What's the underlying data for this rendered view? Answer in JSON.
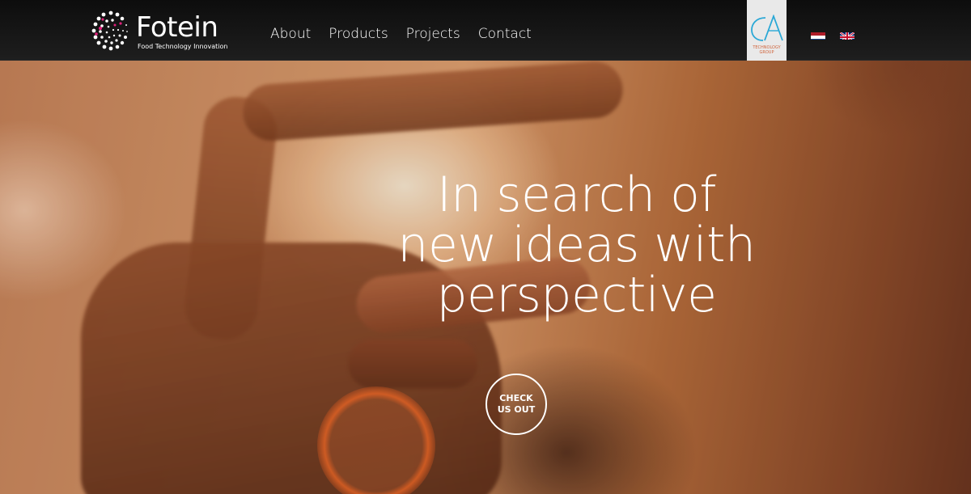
{
  "brand": {
    "name": "Fotein",
    "tagline": "Food Technology Innovation"
  },
  "nav": {
    "items": [
      {
        "label": "About"
      },
      {
        "label": "Products"
      },
      {
        "label": "Projects"
      },
      {
        "label": "Contact"
      }
    ]
  },
  "partner": {
    "logo_text": "TECHNOLOGY GROUP",
    "accent_color": "#2aa8d6"
  },
  "languages": [
    {
      "code": "nl",
      "icon": "netherlands-flag-icon"
    },
    {
      "code": "en",
      "icon": "uk-flag-icon"
    }
  ],
  "hero": {
    "headline_lines": [
      "In search of",
      "new ideas with",
      "perspective"
    ],
    "cta_lines": [
      "CHECK",
      "US OUT"
    ]
  },
  "colors": {
    "header_bg": "#111111",
    "logo_accent": "#e0207a",
    "text": "#ffffff"
  }
}
